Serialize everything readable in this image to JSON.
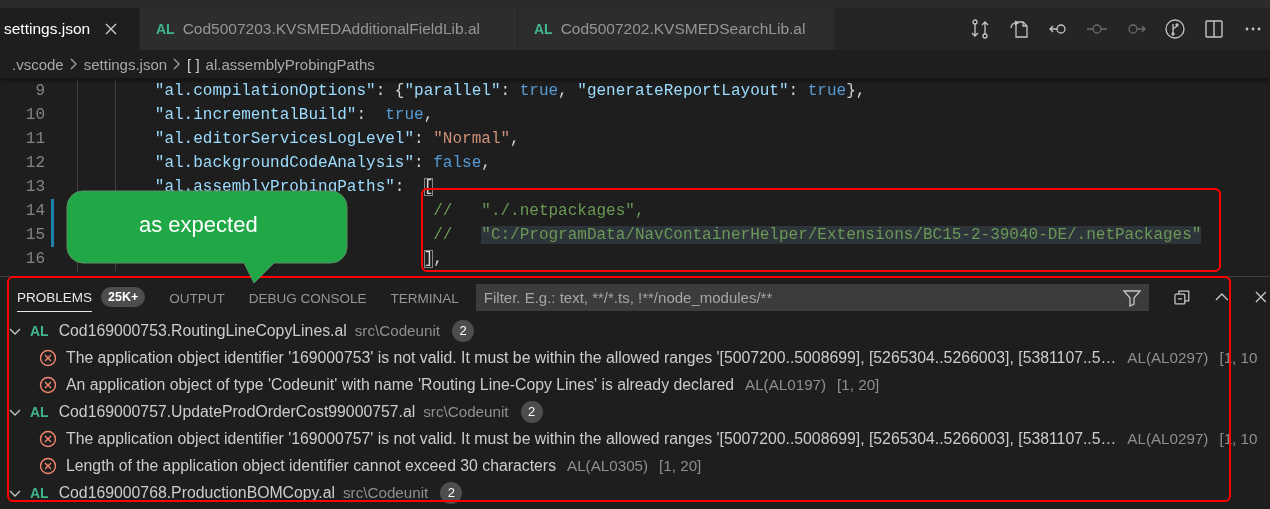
{
  "tabs": [
    {
      "label": "settings.json",
      "selected": true,
      "closable": true
    },
    {
      "label": "Cod5007203.KVSMEDAdditionalFieldLib.al",
      "selected": false,
      "icon_label": "AL",
      "closable": false
    },
    {
      "label": "Cod5007202.KVSMEDSearchLib.al",
      "selected": false,
      "icon_label": "AL",
      "closable": false
    }
  ],
  "toolbar": [
    {
      "kind": "compare",
      "disabled": false
    },
    {
      "kind": "open-file",
      "disabled": false
    },
    {
      "kind": "previous",
      "disabled": false
    },
    {
      "kind": "commit",
      "disabled": true
    },
    {
      "kind": "next",
      "disabled": true
    },
    {
      "kind": "branch",
      "disabled": false
    },
    {
      "kind": "split",
      "disabled": false
    },
    {
      "kind": "more",
      "disabled": false
    }
  ],
  "breadcrumb": [
    {
      "label": ".vscode"
    },
    {
      "label": "settings.json"
    },
    {
      "label": "al.assemblyProbingPaths",
      "symbol": "[ ]"
    }
  ],
  "editor": {
    "lines": [
      {
        "number": "9",
        "modified": false,
        "tokens": [
          {
            "kind": "key",
            "text": "        \"al.compilationOptions\""
          },
          {
            "kind": "punct",
            "text": ": {"
          },
          {
            "kind": "key",
            "text": "\"parallel\""
          },
          {
            "kind": "punct",
            "text": ": "
          },
          {
            "kind": "bool",
            "text": "true"
          },
          {
            "kind": "punct",
            "text": ", "
          },
          {
            "kind": "key",
            "text": "\"generateReportLayout\""
          },
          {
            "kind": "punct",
            "text": ": "
          },
          {
            "kind": "bool",
            "text": "true"
          },
          {
            "kind": "punct",
            "text": "},"
          }
        ]
      },
      {
        "number": "10",
        "modified": false,
        "tokens": [
          {
            "kind": "key",
            "text": "        \"al.incrementalBuild\""
          },
          {
            "kind": "punct",
            "text": ":  "
          },
          {
            "kind": "bool",
            "text": "true"
          },
          {
            "kind": "punct",
            "text": ","
          }
        ]
      },
      {
        "number": "11",
        "modified": false,
        "tokens": [
          {
            "kind": "key",
            "text": "        \"al.editorServicesLogLevel\""
          },
          {
            "kind": "punct",
            "text": ": "
          },
          {
            "kind": "string",
            "text": "\"Normal\""
          },
          {
            "kind": "punct",
            "text": ","
          }
        ]
      },
      {
        "number": "12",
        "modified": false,
        "tokens": [
          {
            "kind": "key",
            "text": "        \"al.backgroundCodeAnalysis\""
          },
          {
            "kind": "punct",
            "text": ": "
          },
          {
            "kind": "bool",
            "text": "false"
          },
          {
            "kind": "punct",
            "text": ","
          }
        ]
      },
      {
        "number": "13",
        "modified": false,
        "tokens": [
          {
            "kind": "key",
            "text": "        \"al.assemblyProbingPaths\""
          },
          {
            "kind": "punct",
            "text": ":  "
          },
          {
            "kind": "bracket",
            "text": "["
          }
        ]
      },
      {
        "number": "14",
        "modified": true,
        "tokens": [
          {
            "kind": "comment",
            "text": "                                     //   \"./.netpackages\","
          }
        ]
      },
      {
        "number": "15",
        "modified": true,
        "tokens": [
          {
            "kind": "comment",
            "text": "                                     //   "
          },
          {
            "kind": "comment-highlight",
            "text": "\"C:/ProgramData/NavContainerHelper/Extensions/BC15-2-39040-DE/.netPackages\""
          }
        ]
      },
      {
        "number": "16",
        "modified": false,
        "tokens": [
          {
            "kind": "bracket",
            "text": "                                    ]"
          },
          {
            "kind": "punct",
            "text": ","
          }
        ]
      }
    ]
  },
  "panel": {
    "tabs": [
      {
        "label": "PROBLEMS",
        "selected": true,
        "badge": "25K+"
      },
      {
        "label": "OUTPUT",
        "selected": false
      },
      {
        "label": "DEBUG CONSOLE",
        "selected": false
      },
      {
        "label": "TERMINAL",
        "selected": false
      }
    ],
    "filter": {
      "placeholder": "Filter. E.g.: text, **/*.ts, !**/node_modules/**"
    },
    "problems": [
      {
        "kind": "file",
        "expanded": true,
        "type_label": "AL",
        "name": "Cod169000753.RoutingLineCopyLines.al",
        "path": "src\\Codeunit",
        "count": "2"
      },
      {
        "kind": "error",
        "message": "The application object identifier '169000753' is not valid. It must be within the allowed ranges '[5007200..5008699], [5265304..5266003], [5381107..5…",
        "code": "AL(AL0297)",
        "position": "[1, 10"
      },
      {
        "kind": "error",
        "message": "An application object of type 'Codeunit' with name 'Routing Line-Copy Lines' is already declared",
        "code": "AL(AL0197)",
        "position": "[1, 20]"
      },
      {
        "kind": "file",
        "expanded": true,
        "type_label": "AL",
        "name": "Cod169000757.UpdateProdOrderCost99000757.al",
        "path": "src\\Codeunit",
        "count": "2"
      },
      {
        "kind": "error",
        "message": "The application object identifier '169000757' is not valid. It must be within the allowed ranges '[5007200..5008699], [5265304..5266003], [5381107..5…",
        "code": "AL(AL0297)",
        "position": "[1, 10"
      },
      {
        "kind": "error",
        "message": "Length of the application object identifier cannot exceed 30 characters",
        "code": "AL(AL0305)",
        "position": "[1, 20]"
      },
      {
        "kind": "file",
        "expanded": true,
        "type_label": "AL",
        "name": "Cod169000768.ProductionBOMCopy.al",
        "path": "src\\Codeunit",
        "count": "2"
      }
    ]
  },
  "annotations": {
    "callout": "as expected"
  }
}
